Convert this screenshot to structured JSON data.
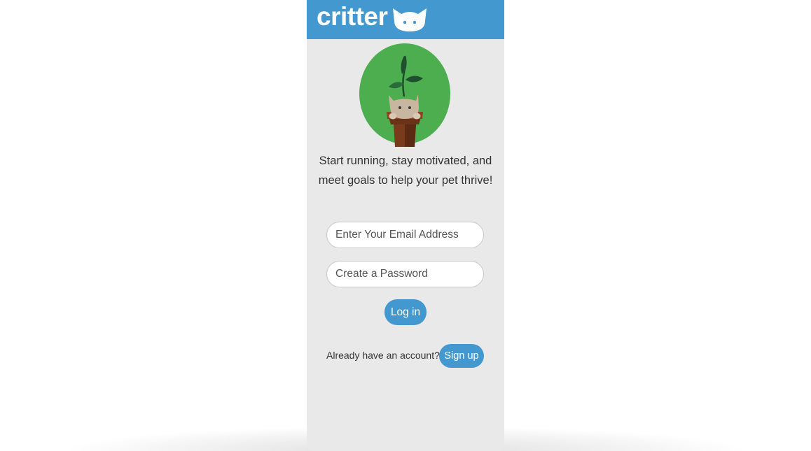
{
  "header": {
    "logo_text": "critter",
    "logo_icon": "cat-face-icon"
  },
  "hero": {
    "icon": "cat-in-flower-pot-illustration"
  },
  "tagline": "Start running, stay motivated, and meet goals to help your pet thrive!",
  "form": {
    "email_placeholder": "Enter Your Email Address",
    "email_value": "",
    "password_placeholder": "Create a Password",
    "password_value": "",
    "login_label": "Log in"
  },
  "footer": {
    "already_text": "Already have an account?",
    "signup_label": "Sign up"
  },
  "colors": {
    "brand_blue": "#4399cf",
    "panel_gray": "#e9e9e9",
    "hero_green": "#4cae4f"
  }
}
